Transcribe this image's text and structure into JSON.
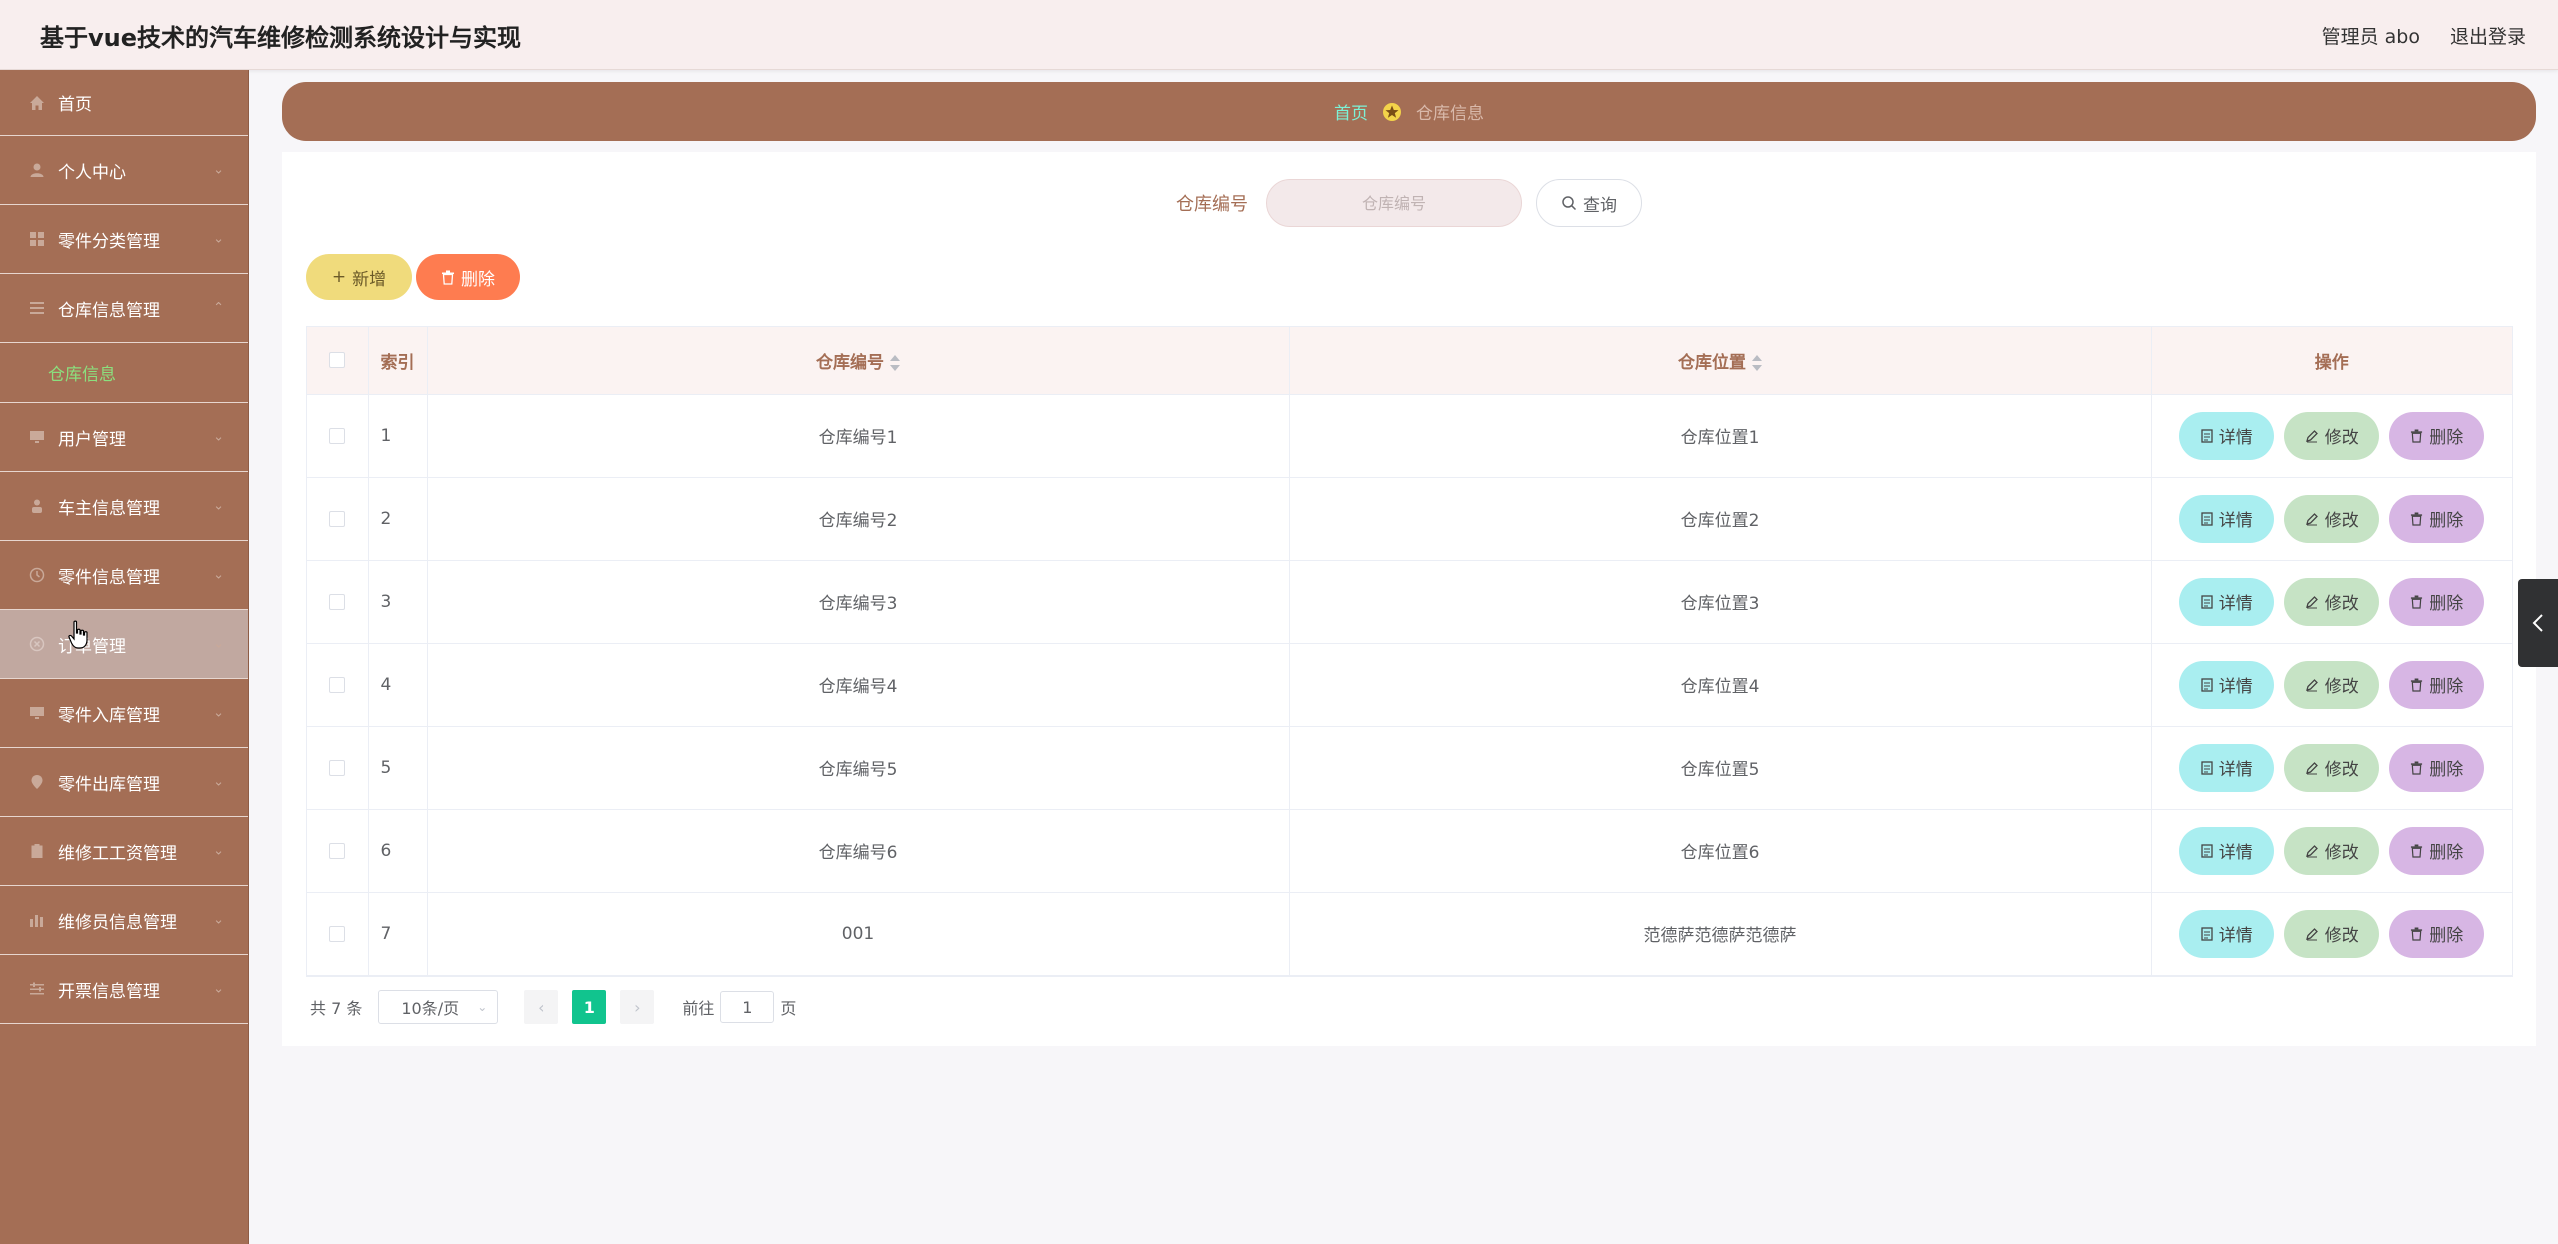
{
  "header": {
    "title": "基于vue技术的汽车维修检测系统设计与实现",
    "user_label": "管理员 abo",
    "logout_label": "退出登录"
  },
  "sidebar": {
    "items": [
      {
        "label": "首页",
        "icon": "home-icon"
      },
      {
        "label": "个人中心",
        "icon": "user-icon"
      },
      {
        "label": "零件分类管理",
        "icon": "grid-icon"
      },
      {
        "label": "仓库信息管理",
        "icon": "list-icon",
        "expanded": true,
        "children": [
          {
            "label": "仓库信息"
          }
        ]
      },
      {
        "label": "用户管理",
        "icon": "monitor-icon"
      },
      {
        "label": "车主信息管理",
        "icon": "person-icon"
      },
      {
        "label": "零件信息管理",
        "icon": "clock-icon"
      },
      {
        "label": "订单管理",
        "icon": "close-circle-icon"
      },
      {
        "label": "零件入库管理",
        "icon": "monitor-icon"
      },
      {
        "label": "零件出库管理",
        "icon": "location-icon"
      },
      {
        "label": "维修工工资管理",
        "icon": "clipboard-icon"
      },
      {
        "label": "维修员信息管理",
        "icon": "bar-chart-icon"
      },
      {
        "label": "开票信息管理",
        "icon": "sliders-icon"
      }
    ]
  },
  "breadcrumb": {
    "home": "首页",
    "current": "仓库信息"
  },
  "search": {
    "label": "仓库编号",
    "placeholder": "仓库编号",
    "button": "查询"
  },
  "actions": {
    "add": "新增",
    "delete": "删除"
  },
  "table": {
    "columns": {
      "index": "索引",
      "warehouse_no": "仓库编号",
      "warehouse_location": "仓库位置",
      "operations": "操作"
    },
    "rows": [
      {
        "index": "1",
        "no": "仓库编号1",
        "location": "仓库位置1"
      },
      {
        "index": "2",
        "no": "仓库编号2",
        "location": "仓库位置2"
      },
      {
        "index": "3",
        "no": "仓库编号3",
        "location": "仓库位置3"
      },
      {
        "index": "4",
        "no": "仓库编号4",
        "location": "仓库位置4"
      },
      {
        "index": "5",
        "no": "仓库编号5",
        "location": "仓库位置5"
      },
      {
        "index": "6",
        "no": "仓库编号6",
        "location": "仓库位置6"
      },
      {
        "index": "7",
        "no": "001",
        "location": "范德萨范德萨范德萨"
      }
    ],
    "op_labels": {
      "detail": "详情",
      "edit": "修改",
      "delete": "删除"
    }
  },
  "pagination": {
    "total": "共 7 条",
    "page_size": "10条/页",
    "current_page": "1",
    "goto_prefix": "前往",
    "goto_value": "1",
    "goto_suffix": "页"
  },
  "colors": {
    "sidebar": "#a46e55",
    "accent_green": "#11c48e",
    "submenu_active": "#8be07e"
  }
}
